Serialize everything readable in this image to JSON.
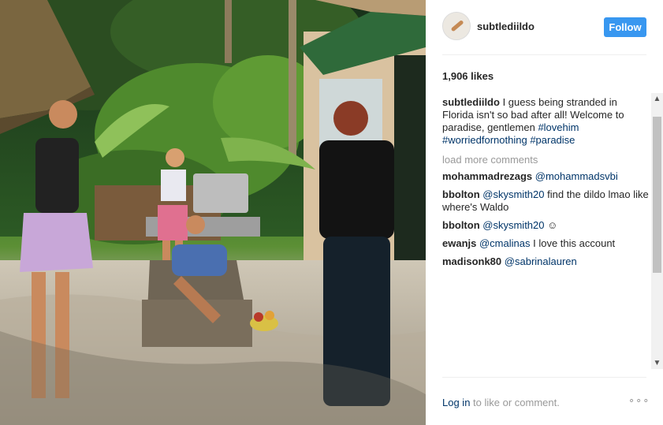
{
  "post": {
    "username": "subtlediildo",
    "follow_label": "Follow",
    "likes_text": "1,906 likes",
    "caption": {
      "user": "subtlediildo",
      "text": "I guess being stranded in Florida isn't so bad after all! Welcome to paradise, gentlemen",
      "hashtags": [
        "#lovehim",
        "#worriedfornothing",
        "#paradise"
      ]
    },
    "load_more_label": "load more comments",
    "comments": [
      {
        "user": "mohammadrezags",
        "parts": [
          {
            "kind": "mention",
            "text": "@mohammadsvbi"
          }
        ]
      },
      {
        "user": "bbolton",
        "parts": [
          {
            "kind": "mention",
            "text": "@skysmith20"
          },
          {
            "kind": "text",
            "text": "find the dildo lmao like where's Waldo"
          }
        ]
      },
      {
        "user": "bbolton",
        "parts": [
          {
            "kind": "mention",
            "text": "@skysmith20"
          },
          {
            "kind": "text",
            "text": "☺"
          }
        ]
      },
      {
        "user": "ewanjs",
        "parts": [
          {
            "kind": "mention",
            "text": "@cmalinas"
          },
          {
            "kind": "text",
            "text": "I love this account"
          }
        ]
      },
      {
        "user": "madisonk80",
        "parts": [
          {
            "kind": "mention",
            "text": "@sabrinalauren"
          }
        ]
      }
    ],
    "footer": {
      "login_label": "Log in",
      "rest_text": "to like or comment.",
      "more_icon": "more-horizontal-icon",
      "more_glyph": "∘∘∘"
    }
  },
  "scrollbar": {
    "up_glyph": "▲",
    "down_glyph": "▼"
  },
  "colors": {
    "follow_button": "#3897f0",
    "link": "#003569",
    "muted": "#999999",
    "text": "#262626"
  }
}
